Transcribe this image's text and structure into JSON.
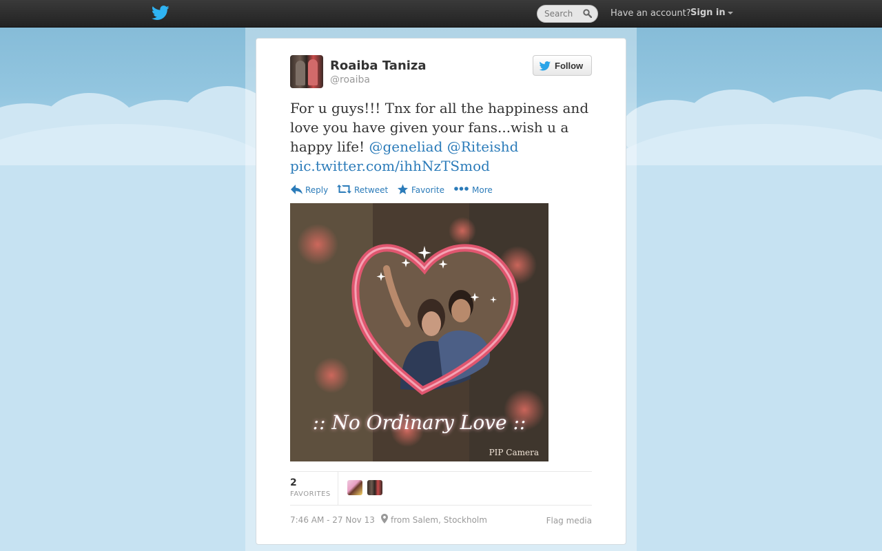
{
  "topbar": {
    "logo_icon": "twitter-bird-icon",
    "search_placeholder": "Search",
    "search_icon": "magnifier-icon",
    "have_account": "Have an account?",
    "sign_in": "Sign in"
  },
  "tweet": {
    "full_name": "Roaiba Taniza",
    "username": "@roaiba",
    "follow_label": "Follow",
    "text": "For u guys!!! Tnx for all the happiness and love you have given your fans...wish u a happy life!",
    "mentions": [
      "@geneliad",
      "@Riteishd"
    ],
    "link": "pic.twitter.com/ihhNzTSmod",
    "actions": {
      "reply": "Reply",
      "retweet": "Retweet",
      "favorite": "Favorite",
      "more": "More"
    },
    "photo": {
      "caption": ":: No Ordinary Love ::",
      "credit": "PIP Camera"
    },
    "favorites": {
      "count": "2",
      "label": "FAVORITES"
    },
    "timestamp": "7:46 AM - 27 Nov 13",
    "location": "from Salem, Stockholm",
    "flag": "Flag media"
  },
  "colors": {
    "link": "#2b7bb9",
    "topbar": "#2d2d2d",
    "sky": "#93c6e0",
    "heart_frame": "#e0566f"
  }
}
